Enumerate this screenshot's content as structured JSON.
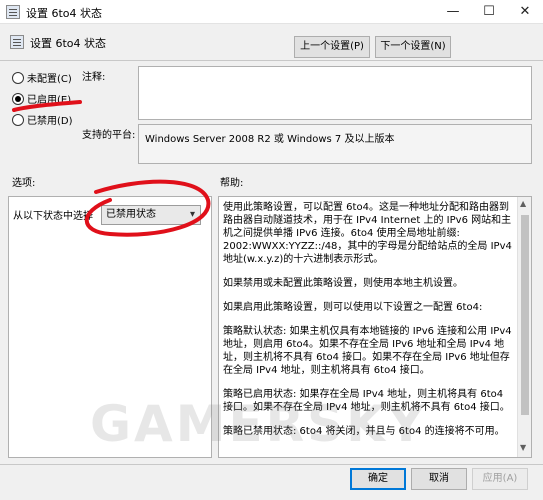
{
  "window": {
    "title": "设置 6to4 状态",
    "minimize": "—",
    "maximize": "☐",
    "close": "✕"
  },
  "header": {
    "subtitle": "设置 6to4 状态",
    "prev_button": "上一个设置(P)",
    "next_button": "下一个设置(N)"
  },
  "state_options": [
    {
      "label": "未配置(C)",
      "selected": false
    },
    {
      "label": "已启用(E)",
      "selected": true
    },
    {
      "label": "已禁用(D)",
      "selected": false
    }
  ],
  "comment": {
    "label": "注释:",
    "value": ""
  },
  "platform": {
    "label": "支持的平台:",
    "value": "Windows Server 2008 R2 或 Windows 7 及以上版本"
  },
  "options": {
    "label": "选项:",
    "state_label": "从以下状态中选择",
    "selected_value": "已禁用状态"
  },
  "help": {
    "label": "帮助:",
    "paragraphs": [
      "使用此策略设置，可以配置 6to4。这是一种地址分配和路由器到路由器自动隧道技术，用于在 IPv4 Internet 上的 IPv6 网站和主机之间提供单播 IPv6 连接。6to4 使用全局地址前缀: 2002:WWXX:YYZZ::/48，其中的字母是分配给站点的全局 IPv4 地址(w.x.y.z)的十六进制表示形式。",
      "如果禁用或未配置此策略设置，则使用本地主机设置。",
      "如果启用此策略设置，则可以使用以下设置之一配置 6to4:",
      "策略默认状态: 如果主机仅具有本地链接的 IPv6 连接和公用 IPv4 地址，则启用 6to4。如果不存在全局 IPv6 地址和全局 IPv4 地址，则主机将不具有 6to4 接口。如果不存在全局 IPv6 地址但存在全局 IPv4 地址，则主机将具有 6to4 接口。",
      "策略已启用状态: 如果存在全局 IPv4 地址，则主机将具有 6to4 接口。如果不存在全局 IPv4 地址，则主机将不具有 6to4 接口。",
      "策略已禁用状态: 6to4 将关闭，并且与 6to4 的连接将不可用。"
    ]
  },
  "footer": {
    "ok": "确定",
    "cancel": "取消",
    "apply": "应用(A)"
  },
  "watermark": "GAMERSKY",
  "colors": {
    "annotation": "#e0101a",
    "accent": "#0078d7"
  }
}
